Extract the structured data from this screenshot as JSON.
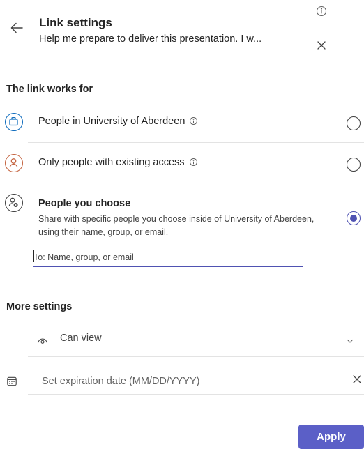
{
  "header": {
    "title": "Link settings",
    "subtitle": "Help me prepare to deliver this presentation. I w...",
    "back_icon": "arrow-left-icon",
    "info_icon": "info-icon",
    "close_icon": "close-icon"
  },
  "link_works_for": {
    "heading": "The link works for",
    "options": [
      {
        "label": "People in University of Aberdeen",
        "icon": "briefcase-icon",
        "has_info": true,
        "selected": false
      },
      {
        "label": "Only people with existing access",
        "icon": "person-icon",
        "has_info": true,
        "selected": false
      },
      {
        "label": "People you choose",
        "icon": "person-settings-icon",
        "has_info": false,
        "selected": true,
        "description": "Share with specific people you choose inside of University of Aberdeen, using their name, group, or email."
      }
    ],
    "recipients_input": {
      "value": "",
      "placeholder": "To: Name, group, or email"
    }
  },
  "more_settings": {
    "heading": "More settings",
    "permission": {
      "label": "Can view",
      "icon": "eye-icon",
      "chevron": "chevron-down-icon"
    },
    "expiration": {
      "value": "",
      "placeholder": "Set expiration date (MM/DD/YYYY)",
      "icon": "calendar-icon"
    }
  },
  "footer": {
    "apply_label": "Apply"
  },
  "colors": {
    "accent": "#5b5fc7",
    "radio_selected": "#4f52b2",
    "org_icon": "#0f6cbd",
    "existing_access_icon": "#c4633f",
    "text_primary": "#242424"
  }
}
